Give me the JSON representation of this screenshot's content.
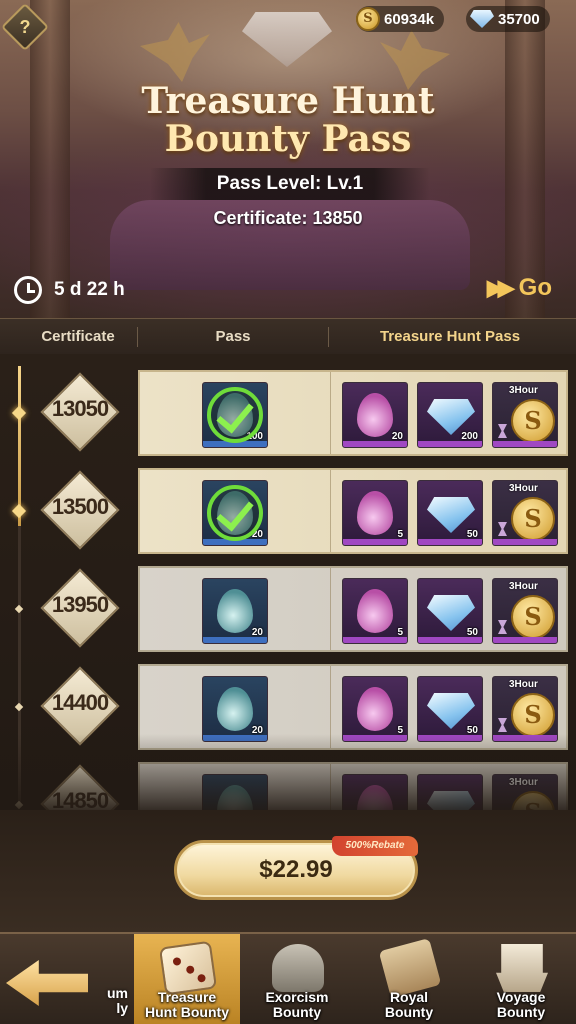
{
  "currencies": {
    "gold": {
      "value": "60934k",
      "icon": "gold-coin-icon",
      "symbol": "S"
    },
    "diamonds": {
      "value": "35700",
      "icon": "diamond-icon"
    }
  },
  "help_label": "?",
  "title": {
    "line1": "Treasure Hunt",
    "line2": "Bounty Pass"
  },
  "pass_level": "Pass Level: Lv.1",
  "certificate_total": "Certificate: 13850",
  "timer": "5 d 22 h",
  "go_label": "Go",
  "go_arrows": "▶▶",
  "columns": {
    "certificate": "Certificate",
    "pass": "Pass",
    "treasure_hunt_pass": "Treasure Hunt Pass"
  },
  "rows": [
    {
      "level": "13050",
      "unlocked": true,
      "pass_item": {
        "type": "soul-drop",
        "qty": "100",
        "claimed": true
      },
      "premium": [
        {
          "type": "purple-drop",
          "qty": "20"
        },
        {
          "type": "diamond",
          "qty": "200"
        },
        {
          "type": "gold-coin-timed",
          "tag": "3Hour"
        }
      ]
    },
    {
      "level": "13500",
      "unlocked": true,
      "pass_item": {
        "type": "soul-drop",
        "qty": "20",
        "claimed": true
      },
      "premium": [
        {
          "type": "purple-drop",
          "qty": "5"
        },
        {
          "type": "diamond",
          "qty": "50"
        },
        {
          "type": "gold-coin-timed",
          "tag": "3Hour"
        }
      ]
    },
    {
      "level": "13950",
      "unlocked": false,
      "pass_item": {
        "type": "soul-drop",
        "qty": "20",
        "claimed": false
      },
      "premium": [
        {
          "type": "purple-drop",
          "qty": "5"
        },
        {
          "type": "diamond",
          "qty": "50"
        },
        {
          "type": "gold-coin-timed",
          "tag": "3Hour"
        }
      ]
    },
    {
      "level": "14400",
      "unlocked": false,
      "pass_item": {
        "type": "soul-drop",
        "qty": "20",
        "claimed": false
      },
      "premium": [
        {
          "type": "purple-drop",
          "qty": "5"
        },
        {
          "type": "diamond",
          "qty": "50"
        },
        {
          "type": "gold-coin-timed",
          "tag": "3Hour"
        }
      ]
    },
    {
      "level": "14850",
      "unlocked": false,
      "pass_item": {
        "type": "soul-drop",
        "qty": "",
        "claimed": false
      },
      "premium": [
        {
          "type": "purple-drop",
          "qty": ""
        },
        {
          "type": "diamond",
          "qty": ""
        },
        {
          "type": "gold-coin-timed",
          "tag": "3Hour"
        }
      ]
    }
  ],
  "purchase": {
    "price": "$22.99",
    "rebate": "500%Rebate"
  },
  "nav": {
    "partial_tab": "um\nly",
    "tabs": [
      {
        "label": "Treasure\nHunt Bounty",
        "icon": "dice-icon",
        "active": true
      },
      {
        "label": "Exorcism\nBounty",
        "icon": "helmet-icon",
        "active": false
      },
      {
        "label": "Royal\nBounty",
        "icon": "scroll-icon",
        "active": false
      },
      {
        "label": "Voyage\nBounty",
        "icon": "ship-icon",
        "active": false
      }
    ]
  },
  "colors": {
    "accent_gold": "#f3c65b",
    "active_tab": "#e8b452",
    "claimed_check": "#6fdc3a",
    "rebate_red": "#d2432f"
  }
}
